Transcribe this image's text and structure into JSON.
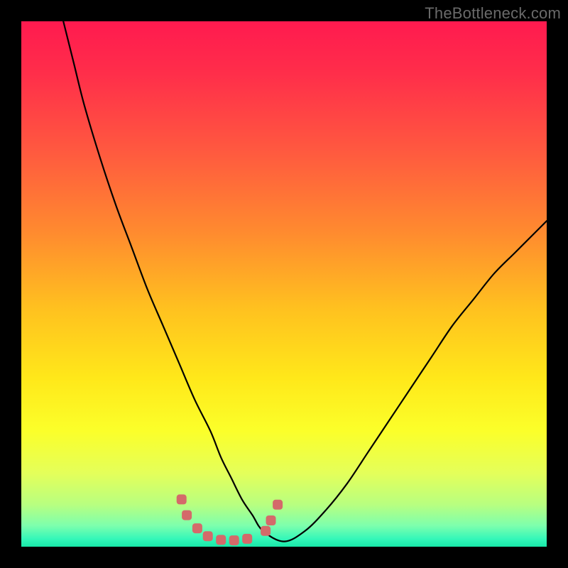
{
  "watermark": "TheBottleneck.com",
  "colors": {
    "background": "#000000",
    "watermark": "#6a6a6a",
    "curve": "#000000",
    "marker_fill": "#d46a6a",
    "gradient_stops": [
      {
        "offset": 0.0,
        "color": "#ff1a4f"
      },
      {
        "offset": 0.1,
        "color": "#ff2e4a"
      },
      {
        "offset": 0.25,
        "color": "#ff5a3f"
      },
      {
        "offset": 0.4,
        "color": "#ff8a2f"
      },
      {
        "offset": 0.55,
        "color": "#ffc21f"
      },
      {
        "offset": 0.68,
        "color": "#ffe81a"
      },
      {
        "offset": 0.78,
        "color": "#fbff2a"
      },
      {
        "offset": 0.86,
        "color": "#e4ff5a"
      },
      {
        "offset": 0.92,
        "color": "#b8ff80"
      },
      {
        "offset": 0.96,
        "color": "#7dffad"
      },
      {
        "offset": 0.985,
        "color": "#34f7b9"
      },
      {
        "offset": 1.0,
        "color": "#18e8a8"
      }
    ]
  },
  "chart_data": {
    "type": "line",
    "title": "",
    "xlabel": "",
    "ylabel": "",
    "xlim": [
      0,
      100
    ],
    "ylim": [
      0,
      100
    ],
    "grid": false,
    "legend": false,
    "series": [
      {
        "name": "bottleneck-curve",
        "x": [
          8,
          10,
          12,
          15,
          18,
          21,
          24,
          27,
          30,
          33,
          36,
          38,
          40,
          42,
          44,
          46,
          50,
          54,
          58,
          62,
          66,
          70,
          74,
          78,
          82,
          86,
          90,
          94,
          98,
          100
        ],
        "y": [
          100,
          92,
          84,
          74,
          65,
          57,
          49,
          42,
          35,
          28,
          22,
          17,
          13,
          9,
          6,
          3,
          1,
          3,
          7,
          12,
          18,
          24,
          30,
          36,
          42,
          47,
          52,
          56,
          60,
          62
        ]
      }
    ],
    "markers": {
      "name": "highlight-dots",
      "x": [
        30.5,
        31.5,
        33.5,
        35.5,
        38.0,
        40.5,
        43.0,
        46.5,
        47.5,
        48.8
      ],
      "y": [
        9.0,
        6.0,
        3.5,
        2.0,
        1.3,
        1.2,
        1.5,
        3.0,
        5.0,
        8.0
      ]
    }
  }
}
